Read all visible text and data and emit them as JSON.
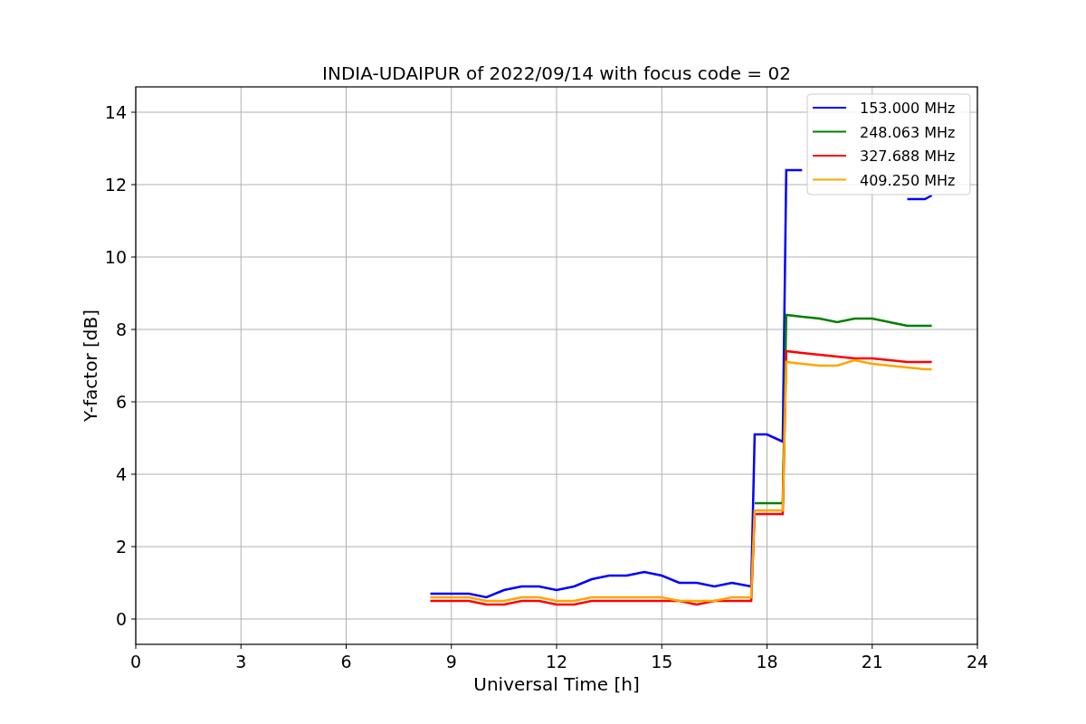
{
  "chart_data": {
    "type": "line",
    "title": "INDIA-UDAIPUR of 2022/09/14 with focus code = 02",
    "xlabel": "Universal Time [h]",
    "ylabel": "Y-factor [dB]",
    "x": [
      8.4,
      9,
      9.5,
      10,
      10.5,
      11,
      11.5,
      12,
      12.5,
      13,
      13.5,
      14,
      14.5,
      15,
      15.5,
      16,
      16.5,
      17,
      17.55,
      17.65,
      18,
      18.45,
      18.55,
      19,
      19.5,
      20,
      20.5,
      21,
      21.5,
      22,
      22.5,
      22.7
    ],
    "series": [
      {
        "name": "153.000 MHz",
        "color": "#0000ff",
        "values": [
          0.7,
          0.7,
          0.7,
          0.6,
          0.8,
          0.9,
          0.9,
          0.8,
          0.9,
          1.1,
          1.2,
          1.2,
          1.3,
          1.2,
          1.0,
          1.0,
          0.9,
          1.0,
          0.9,
          5.1,
          5.1,
          4.9,
          12.4,
          12.4,
          null,
          null,
          null,
          null,
          null,
          11.6,
          11.6,
          11.7
        ]
      },
      {
        "name": "248.063 MHz",
        "color": "#008000",
        "values": [
          null,
          null,
          null,
          null,
          null,
          null,
          null,
          null,
          null,
          null,
          null,
          null,
          null,
          null,
          null,
          null,
          null,
          null,
          null,
          3.2,
          3.2,
          3.2,
          8.4,
          8.35,
          8.3,
          8.2,
          8.3,
          8.3,
          8.2,
          8.1,
          8.1,
          8.1
        ]
      },
      {
        "name": "327.688 MHz",
        "color": "#ff0000",
        "values": [
          0.5,
          0.5,
          0.5,
          0.4,
          0.4,
          0.5,
          0.5,
          0.4,
          0.4,
          0.5,
          0.5,
          0.5,
          0.5,
          0.5,
          0.5,
          0.4,
          0.5,
          0.5,
          0.5,
          2.9,
          2.9,
          2.9,
          7.4,
          7.35,
          7.3,
          7.25,
          7.2,
          7.2,
          7.15,
          7.1,
          7.1,
          7.1
        ]
      },
      {
        "name": "409.250 MHz",
        "color": "#ffa500",
        "values": [
          0.6,
          0.6,
          0.6,
          0.5,
          0.5,
          0.6,
          0.6,
          0.5,
          0.5,
          0.6,
          0.6,
          0.6,
          0.6,
          0.6,
          0.5,
          0.5,
          0.5,
          0.6,
          0.6,
          3.0,
          3.0,
          3.0,
          7.1,
          7.05,
          7.0,
          7.0,
          7.15,
          7.05,
          7.0,
          6.95,
          6.9,
          6.9
        ]
      }
    ],
    "grid": true,
    "legend": true,
    "xlim": [
      0,
      24
    ],
    "ylim": [
      -0.7,
      14.7
    ],
    "xticks": [
      0,
      3,
      6,
      9,
      12,
      15,
      18,
      21,
      24
    ],
    "yticks": [
      0,
      2,
      4,
      6,
      8,
      10,
      12,
      14
    ]
  }
}
